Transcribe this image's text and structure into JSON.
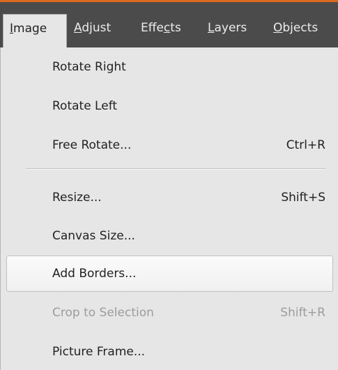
{
  "menubar": {
    "tabs": [
      {
        "pre": "",
        "key": "I",
        "post": "mage"
      },
      {
        "pre": "",
        "key": "A",
        "post": "djust"
      },
      {
        "pre": "Effe",
        "key": "c",
        "post": "ts"
      },
      {
        "pre": "",
        "key": "L",
        "post": "ayers"
      },
      {
        "pre": "",
        "key": "O",
        "post": "bjects"
      }
    ]
  },
  "menu": {
    "items": [
      {
        "label": "Rotate Right",
        "shortcut": ""
      },
      {
        "label": "Rotate Left",
        "shortcut": ""
      },
      {
        "label": "Free Rotate...",
        "shortcut": "Ctrl+R"
      },
      {
        "label": "Resize...",
        "shortcut": "Shift+S"
      },
      {
        "label": "Canvas Size...",
        "shortcut": ""
      },
      {
        "label": "Add Borders...",
        "shortcut": ""
      },
      {
        "label": "Crop to Selection",
        "shortcut": "Shift+R"
      },
      {
        "label": "Picture Frame...",
        "shortcut": ""
      }
    ]
  },
  "colors": {
    "menubar_bg": "#4b4b4b",
    "accent": "#d96a1e",
    "menu_bg": "#e6e6e6",
    "disabled_text": "#9c9c9c"
  }
}
